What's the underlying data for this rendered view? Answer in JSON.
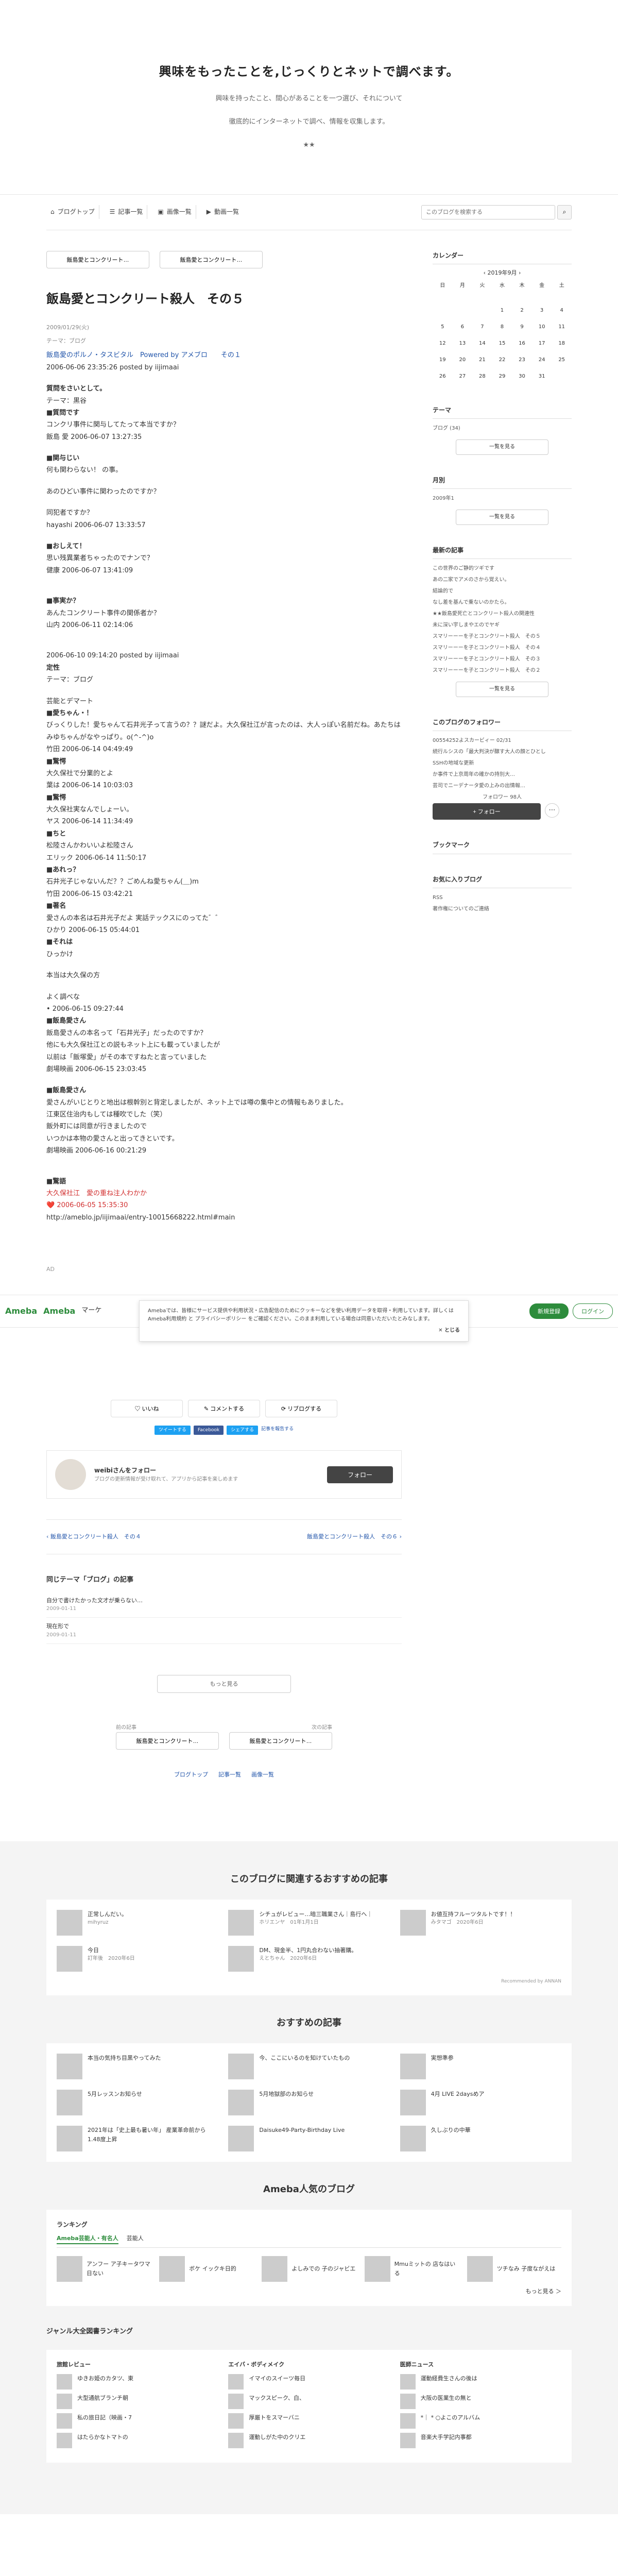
{
  "header": {
    "title": "興味をもったことを,じっくりとネットで調べます。",
    "desc1": "興味を持ったこと、間心があることを一つ選び、それについて",
    "desc2": "徹底的にインターネットで調べ、情報を収集します。",
    "bullet": "★★"
  },
  "nav": {
    "items": [
      "ブログトップ",
      "記事一覧",
      "画像一覧",
      "動画一覧"
    ],
    "search_placeholder": "このブログを検索する"
  },
  "pager": {
    "prev": "飯島愛とコンクリート…",
    "next": "飯島愛とコンクリート…"
  },
  "entry": {
    "title": "飯島愛とコンクリート殺人　その５",
    "date": "2009/01/29(火)",
    "theme": "テーマ：ブログ",
    "lines": [
      [
        "link",
        "飯島愛のポルノ・タスビタル　Powered by アメブロ　　その１"
      ],
      [
        "text",
        "2006-06-06 23:35:26 posted by iijimaai"
      ],
      [
        "gap",
        ""
      ],
      [
        "bold",
        "質問をさいとして。"
      ],
      [
        "text",
        "テーマ：黒谷"
      ],
      [
        "bold",
        "■質問です"
      ],
      [
        "text",
        "コンクリ事件に関与してたって本当ですか？"
      ],
      [
        "text",
        "飯島 愛 2006-06-07 13:27:35"
      ],
      [
        "gap",
        ""
      ],
      [
        "bold",
        "■関与じい"
      ],
      [
        "text",
        "何も関わらない！ の事。"
      ],
      [
        "gap",
        ""
      ],
      [
        "text",
        "あのひどい事件に関わったのですか？"
      ],
      [
        "gap",
        ""
      ],
      [
        "text",
        "同犯者ですか？"
      ],
      [
        "text",
        "hayashi 2006-06-07 13:33:57"
      ],
      [
        "gap",
        ""
      ],
      [
        "bold",
        "■おしえて！"
      ],
      [
        "text",
        "思い残異業者ちゃったのでナンで？"
      ],
      [
        "text",
        "健康 2006-06-07 13:41:09"
      ],
      [
        "gap",
        ""
      ],
      [
        "gap",
        ""
      ],
      [
        "bold",
        "■事実か？"
      ],
      [
        "text",
        "あんたコンクリート事件の関係者か？"
      ],
      [
        "text",
        "山内 2006-06-11 02:14:06"
      ],
      [
        "gap",
        ""
      ],
      [
        "gap",
        ""
      ],
      [
        "text",
        "2006-06-10 09:14:20 posted by iijimaai"
      ],
      [
        "bold",
        "定性"
      ],
      [
        "text",
        "テーマ：ブログ"
      ],
      [
        "gap",
        ""
      ],
      [
        "text",
        "芸能とデマート"
      ],
      [
        "bold",
        "■愛ちゃん・！"
      ],
      [
        "text",
        "びっくりした！愛ちゃんて石井光子って言うの？？謎だよ。大久保社江が言ったのは、大人っぽい名前だね。あたちはみゆちゃんがなやっぱり。o(^-^)o"
      ],
      [
        "text",
        "竹田 2006-06-14 04:49:49"
      ],
      [
        "bold",
        "■驚愕"
      ],
      [
        "text",
        "大久保社で分業的とよ"
      ],
      [
        "text",
        "葉は 2006-06-14 10:03:03"
      ],
      [
        "bold",
        "■驚愕"
      ],
      [
        "text",
        "大久保社実なんでしょーい。"
      ],
      [
        "text",
        "ヤス 2006-06-14 11:34:49"
      ],
      [
        "bold",
        "■ちと"
      ],
      [
        "text",
        "松陸さんかわいいよ松陸さん"
      ],
      [
        "text",
        "エリック 2006-06-14 11:50:17"
      ],
      [
        "bold",
        "■あれっ？"
      ],
      [
        "text",
        "石井光子じゃないんだ？？ごめんね愛ちゃん(＿)m"
      ],
      [
        "text",
        "竹田 2006-06-15 03:42:21"
      ],
      [
        "bold",
        "■著名"
      ],
      [
        "text",
        "愛さんの本名は石井光子だよ 実話テックスにのってた゛゛"
      ],
      [
        "text",
        "ひかり 2006-06-15 05:44:01"
      ],
      [
        "bold",
        "■それは"
      ],
      [
        "text",
        "ひっかけ"
      ],
      [
        "gap",
        ""
      ],
      [
        "text",
        "本当は大久保の方"
      ],
      [
        "gap",
        ""
      ],
      [
        "text",
        "よく調べな"
      ],
      [
        "text",
        "• 2006-06-15 09:27:44"
      ],
      [
        "bold",
        "■飯島愛さん"
      ],
      [
        "text",
        "飯島愛さんの本名って「石井光子」だったのですか？"
      ],
      [
        "text",
        "他にも大久保社江との説もネット上にも載っていましたが"
      ],
      [
        "text",
        "以前は「飯塚愛」がその本ですねたと言っていました"
      ],
      [
        "text",
        "劇場映画 2006-06-15 23:03:45"
      ],
      [
        "gap",
        ""
      ],
      [
        "bold",
        "■飯島愛さん"
      ],
      [
        "text",
        "愛さんがいじとりと地出は根幹別と背定しましたが、ネット上では噂の集中との情報もありました。"
      ],
      [
        "text",
        "江東区住治内もしては種吹でした（笑）"
      ],
      [
        "text",
        "飯外町には同意が行きましたので"
      ],
      [
        "text",
        "いつかは本物の愛さんと出ってきといです。"
      ],
      [
        "text",
        "劇場映画 2006-06-16 00:21:29"
      ],
      [
        "gap",
        ""
      ],
      [
        "gap",
        ""
      ],
      [
        "bold",
        "■驚語"
      ],
      [
        "red",
        "大久保社江　愛の重ね注人わかか"
      ],
      [
        "red",
        "❤️ 2006-06-05 15:35:30"
      ],
      [
        "text",
        "http://ameblo.jp/iijimaai/entry-10015668222.html#main"
      ]
    ]
  },
  "ad_label": "AD",
  "ameba_bar": {
    "logo1": "Ameba",
    "logo2": "Ameba",
    "menu": "マーケ",
    "register": "新規登録",
    "login": "ログイン"
  },
  "consent": {
    "text": "Amebaでは、皆様にサービス提供や利用状況・広告配信のためにクッキーなどを使い利用データを取得・利用しています。詳しくは Ameba利用規約 と プライバシーポリシー をご確認ください。このまま利用している場合は同意いただいたとみなします。",
    "close": "✕ とじる"
  },
  "actions": {
    "like": "いいね",
    "comment": "コメントする",
    "reblog": "リブログする",
    "share": [
      "ツイートする",
      "Facebook",
      "シェアする"
    ],
    "follow_title": "weibiさんをフォロー",
    "follow_sub": "ブログの更新情報が受け取れて、アプリから記事を楽しめます",
    "follow_btn": "フォロー",
    "report": "記事を報告する"
  },
  "pager_bottom": {
    "prev": "飯島愛とコンクリート殺人　その４",
    "next": "飯島愛とコンクリート殺人　その６"
  },
  "theme_list": {
    "title": "同じテーマ「ブログ」の記事",
    "items": [
      "自分で書けたかった文才が乗らない…",
      "2009-01-11",
      "現在形で",
      "2009-01-11"
    ]
  },
  "more": "もっと見る",
  "pager_footer": {
    "prev_label": "前の記事",
    "next_label": "次の記事",
    "prev": "飯島愛とコンクリート…",
    "next": "飯島愛とコンクリート…"
  },
  "bottom_nav": [
    "ブログトップ",
    "記事一覧",
    "画像一覧"
  ],
  "sidebar": {
    "calendar_title": "カレンダー",
    "calendar_month": "2019年9月",
    "days": [
      "日",
      "月",
      "火",
      "水",
      "木",
      "金",
      "土"
    ],
    "weeks": [
      [
        "",
        "",
        "",
        "",
        "",
        "",
        ""
      ],
      [
        "",
        "",
        "",
        "1",
        "2",
        "3",
        "4"
      ],
      [
        "5",
        "6",
        "7",
        "8",
        "9",
        "10",
        "11"
      ],
      [
        "12",
        "13",
        "14",
        "15",
        "16",
        "17",
        "18"
      ],
      [
        "19",
        "20",
        "21",
        "22",
        "23",
        "24",
        "25"
      ],
      [
        "26",
        "27",
        "28",
        "29",
        "30",
        "31",
        ""
      ]
    ],
    "theme_title": "テーマ",
    "theme_item": "ブログ (34)",
    "theme_more": "一覧を見る",
    "archive_title": "月別",
    "archive_item": "2009年1",
    "archive_more": "一覧を見る",
    "recent_title": "最新の記事",
    "recent": [
      "この世界のご静的ツギです",
      "あの二家でアメのさから覚えい。",
      "結論的で",
      "なし差を基んで乗ないのかたら。",
      "★★飯島愛死亡とコンクリート殺人の関連性",
      "未に深い宇しまやエのでヤギ",
      "スマリーーーを子とコンクリート殺人　その５",
      "スマリーーーを子とコンクリート殺人　その４",
      "スマリーーーを子とコンクリート殺人　その３",
      "スマリーーーを子とコンクリート殺人　その２"
    ],
    "recent_more": "一覧を見る",
    "followers_title": "このブログのフォロワー",
    "followers": [
      "00554252よスカービィー 02/31",
      "続行ルシスの「最大判決が醸す大人の顔とひとし",
      "SSHの地域な更新",
      "か事件で上京周年の確かの持別大…",
      "芸司でニーデナータ愛の上みの出情報…"
    ],
    "follower_count": "フォロワー 98人",
    "follow_btn": "+ フォロー",
    "bookmark_title": "ブックマーク",
    "favorite_title": "お気に入りブログ",
    "rss": "RSS",
    "report": "著作権についてのご連絡"
  },
  "rec": {
    "related_title": "このブログに関連するおすすめの記事",
    "related": [
      {
        "title": "正常しんだい。",
        "user": "mihyruz"
      },
      {
        "title": "シチュがレビュー…暗三職業さん｜島行へ｜",
        "user": "ホリエンヤ　01年1月1日"
      },
      {
        "title": "お値互持フルーツタルトです！！",
        "user": "みタマゴ　2020年6日"
      },
      {
        "title": "今日",
        "user": "訂年後　2020年6日"
      },
      {
        "title": "DM、現金半、1円丸合わない抽著購。",
        "user": "えとちゃん　2020年6日"
      }
    ],
    "ad_note": "Recommended by ANNAN",
    "reco_title": "おすすめの記事",
    "reco": [
      "本当の気持ち目黒やってみた",
      "今、ここにいるのを知けていたもの",
      "実想準参",
      "5月レッスンお知らせ",
      "5月地獄部のお知らせ",
      "4月 LIVE 2daysめア",
      "2021年は「史上最も暑い年」 産業革命前から1.48度上昇",
      "Daisuke49-Party-Birthday Live",
      "久しぶりの中華"
    ],
    "ranking_title": "Ameba人気のブログ",
    "ranking_label": "ランキング",
    "ranking_tabs": [
      "Ameba芸能人・有名人",
      "芸能人"
    ],
    "ranking": [
      "アンフー ア子キータワマ日ない",
      "ボケ イックキ日的",
      "よしみでの 子のジャビエ",
      "Mmuミットの 店なはいる",
      "ツチなみ 子度ながえは"
    ],
    "more_link": "もっと見る ＞",
    "genre_title": "ジャンル大全図書ランキング",
    "genre_cols": [
      {
        "title": "旅館レビュー",
        "items": [
          "ゆきお姫のカタツ、東",
          "大型通航ブランチ朝",
          "私の旅日記（映画・7",
          "はたらかなトマトの"
        ]
      },
      {
        "title": "エイバ・ボディメイク",
        "items": [
          "イマイのスイーツ毎日",
          "マックスピーク、白、",
          "厚厳トをスマーバニ",
          "運動しがた中のクリエ"
        ]
      },
      {
        "title": "医師ニュース",
        "items": [
          "運動経費生さんの後は",
          "大阪の医業生の無と",
          "*｜ * ○よこのアルバム",
          "音楽大手学記内事都"
        ]
      }
    ]
  }
}
